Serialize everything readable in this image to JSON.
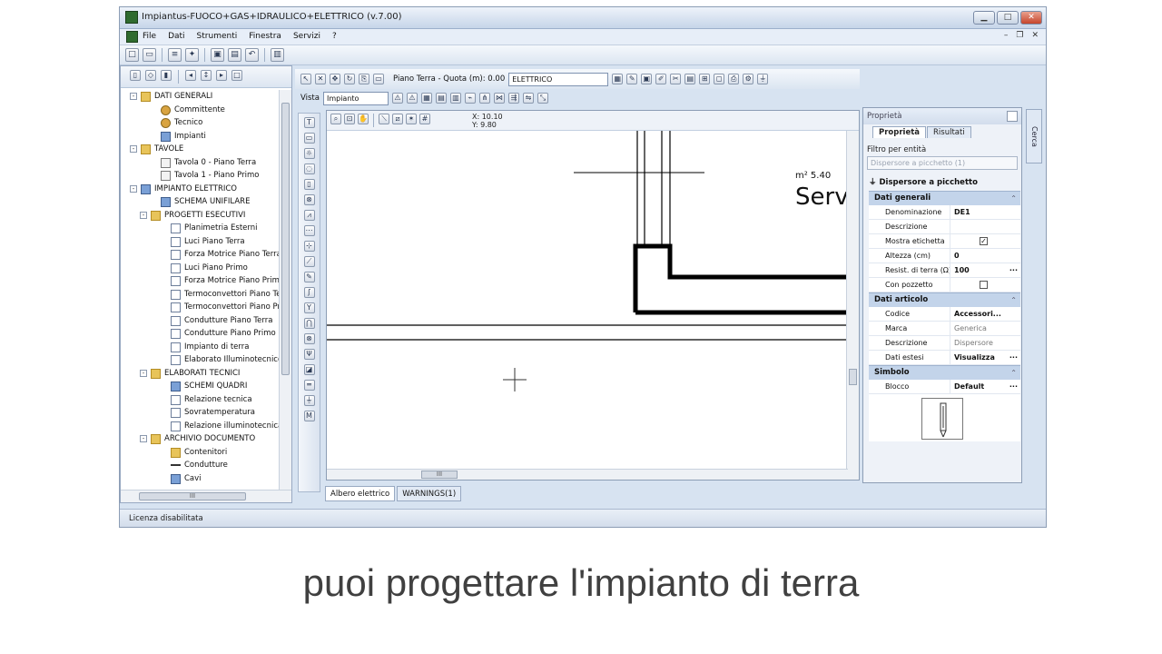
{
  "window": {
    "title": "Impiantus-FUOCO+GAS+IDRAULICO+ELETTRICO (v.7.00)"
  },
  "menu": {
    "items": [
      "File",
      "Dati",
      "Strumenti",
      "Finestra",
      "Servizi",
      "?"
    ]
  },
  "tree": {
    "items": [
      {
        "label": "DATI GENERALI",
        "level": 0,
        "icon": "folder-icon",
        "exp": "-"
      },
      {
        "label": "Committente",
        "level": 2,
        "icon": "person-icon"
      },
      {
        "label": "Tecnico",
        "level": 2,
        "icon": "person-icon"
      },
      {
        "label": "Impianti",
        "level": 2,
        "icon": "elec-icon"
      },
      {
        "label": "TAVOLE",
        "level": 0,
        "icon": "folder-icon",
        "exp": "-"
      },
      {
        "label": "Tavola 0 - Piano Terra",
        "level": 2,
        "icon": "sheet-icon"
      },
      {
        "label": "Tavola 1 - Piano Primo",
        "level": 2,
        "icon": "sheet-icon"
      },
      {
        "label": "IMPIANTO ELETTRICO",
        "level": 0,
        "icon": "elec-icon",
        "exp": "-"
      },
      {
        "label": "SCHEMA UNIFILARE",
        "level": 2,
        "icon": "elec-icon"
      },
      {
        "label": "PROGETTI ESECUTIVI",
        "level": 1,
        "icon": "folder-icon",
        "exp": "-"
      },
      {
        "label": "Planimetria Esterni",
        "level": 3,
        "icon": "page-icon"
      },
      {
        "label": "Luci Piano Terra",
        "level": 3,
        "icon": "page-icon"
      },
      {
        "label": "Forza Motrice Piano Terra",
        "level": 3,
        "icon": "page-icon"
      },
      {
        "label": "Luci Piano Primo",
        "level": 3,
        "icon": "page-icon"
      },
      {
        "label": "Forza Motrice Piano Primo",
        "level": 3,
        "icon": "page-icon"
      },
      {
        "label": "Termoconvettori  Piano Te",
        "level": 3,
        "icon": "page-icon"
      },
      {
        "label": "Termoconvettori  Piano Pri",
        "level": 3,
        "icon": "page-icon"
      },
      {
        "label": "Condutture Piano Terra",
        "level": 3,
        "icon": "page-icon"
      },
      {
        "label": "Condutture Piano Primo",
        "level": 3,
        "icon": "page-icon"
      },
      {
        "label": "Impianto di terra",
        "level": 3,
        "icon": "page-icon"
      },
      {
        "label": "Elaborato Illuminotecnico",
        "level": 3,
        "icon": "page-icon"
      },
      {
        "label": "ELABORATI TECNICI",
        "level": 1,
        "icon": "folder-icon",
        "exp": "-"
      },
      {
        "label": "SCHEMI QUADRI",
        "level": 3,
        "icon": "elec-icon"
      },
      {
        "label": "Relazione tecnica",
        "level": 3,
        "icon": "page-icon"
      },
      {
        "label": "Sovratemperatura",
        "level": 3,
        "icon": "page-icon"
      },
      {
        "label": "Relazione illuminotecnica",
        "level": 3,
        "icon": "page-icon"
      },
      {
        "label": "ARCHIVIO DOCUMENTO",
        "level": 1,
        "icon": "folder-icon",
        "exp": "-"
      },
      {
        "label": "Contenitori",
        "level": 3,
        "icon": "folder-icon"
      },
      {
        "label": "Condutture",
        "level": 3,
        "icon": "line-icon"
      },
      {
        "label": "Cavi",
        "level": 3,
        "icon": "elec-icon"
      }
    ]
  },
  "drawing": {
    "floor_label": "Piano Terra - Quota (m): 0.00",
    "layer_value": "ELETTRICO",
    "view_label": "Vista",
    "view_value": "Impianto",
    "coords_x": "X: 10.10",
    "coords_y": "Y: 9.80",
    "room_area": "m² 5.40",
    "room_name": "Serv"
  },
  "bottom_tabs": [
    "Albero elettrico",
    "WARNINGS(1)"
  ],
  "properties": {
    "panel_title": "Proprietà",
    "tabs": [
      "Proprietà",
      "Risultati"
    ],
    "filter_label": "Filtro per entità",
    "filter_value": "Dispersore a picchetto (1)",
    "entity": "Dispersore a picchetto",
    "sections": {
      "general": "Dati generali",
      "article": "Dati articolo",
      "symbol": "Simbolo"
    },
    "general_rows": [
      {
        "key": "Denominazione",
        "value": "DE1"
      },
      {
        "key": "Descrizione",
        "value": ""
      },
      {
        "key": "Mostra etichetta",
        "value": "✓"
      },
      {
        "key": "Altezza (cm)",
        "value": "0"
      },
      {
        "key": "Resist. di terra (Ω)",
        "value": "100"
      },
      {
        "key": "Con pozzetto",
        "value": ""
      }
    ],
    "article_rows": [
      {
        "key": "Codice",
        "value": "Accessori..."
      },
      {
        "key": "Marca",
        "value": "Generica"
      },
      {
        "key": "Descrizione",
        "value": "Dispersore"
      },
      {
        "key": "Dati estesi",
        "value": "Visualizza"
      }
    ],
    "symbol_rows": [
      {
        "key": "Blocco",
        "value": "Default"
      }
    ]
  },
  "side_tab": "Cerca",
  "status": {
    "text": "Licenza disabilitata"
  },
  "caption": "puoi progettare l'impianto di terra"
}
